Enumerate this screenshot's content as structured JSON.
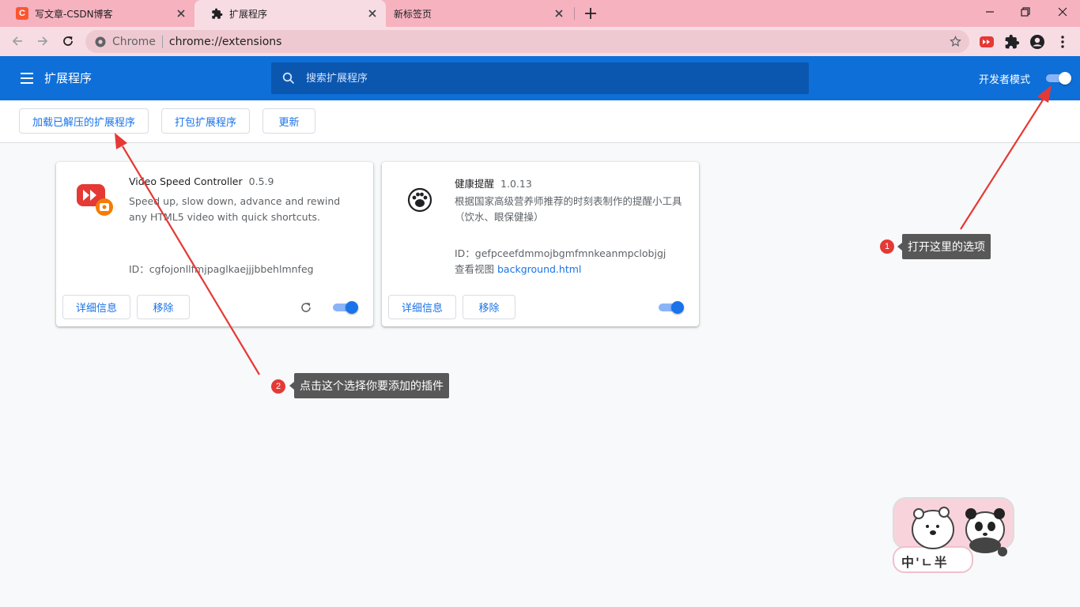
{
  "browser": {
    "tabs": [
      {
        "title": "写文章-CSDN博客",
        "favicon": "csdn-logo",
        "favicon_text": "C"
      },
      {
        "title": "扩展程序",
        "favicon": "puzzle-icon",
        "active": true
      },
      {
        "title": "新标签页"
      }
    ],
    "address": {
      "scheme_label": "Chrome",
      "url": "chrome://extensions"
    }
  },
  "header": {
    "title": "扩展程序",
    "search_placeholder": "搜索扩展程序",
    "dev_mode_label": "开发者模式",
    "dev_mode_on": true
  },
  "dev_toolbar": {
    "load_unpacked": "加载已解压的扩展程序",
    "pack": "打包扩展程序",
    "update": "更新"
  },
  "extensions": [
    {
      "name": "Video Speed Controller",
      "version": "0.5.9",
      "description": "Speed up, slow down, advance and rewind any HTML5 video with quick shortcuts.",
      "id_line": "ID：cgfojonllfmjpaglkaejjjbbehlmnfeg",
      "details": "详细信息",
      "remove": "移除",
      "enabled": true
    },
    {
      "name": "健康提醒",
      "version": "1.0.13",
      "description": "根据国家高级营养师推荐的时刻表制作的提醒小工具（饮水、眼保健操）",
      "id_line": "ID：gefpceefdmmojbgmfmnkeanmpclobjgj",
      "views_label": "查看视图",
      "views_link": "background.html",
      "details": "详细信息",
      "remove": "移除",
      "enabled": true
    }
  ],
  "annotations": [
    {
      "number": "1",
      "text": "打开这里的选项"
    },
    {
      "number": "2",
      "text": "点击这个选择你要添加的插件"
    }
  ],
  "sticker": {
    "text": "中'ㄴ半"
  },
  "colors": {
    "header_blue": "#0e6fd8",
    "link_blue": "#1a73e8",
    "tabstrip_pink": "#f6b2bf",
    "arrow_red": "#e53935",
    "callout_gray": "#585858"
  }
}
